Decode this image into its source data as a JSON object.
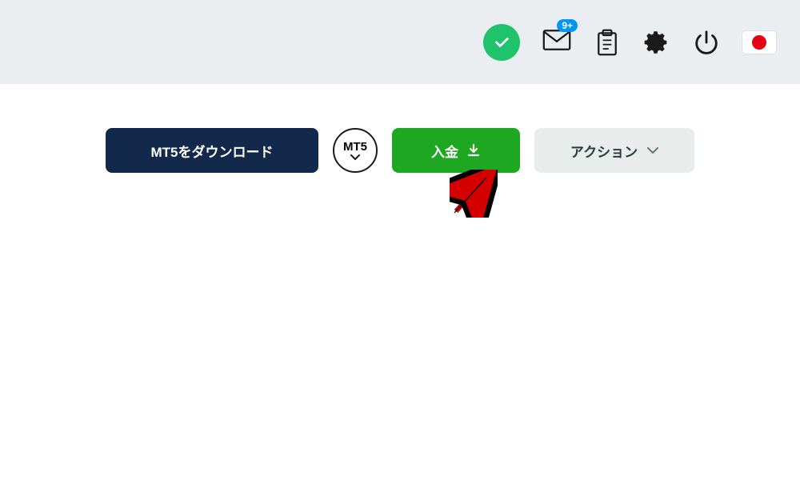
{
  "topbar": {
    "notification_badge": "9+"
  },
  "buttons": {
    "download_label": "MT5をダウンロード",
    "platform_label": "MT5",
    "deposit_label": "入金",
    "action_label": "アクション"
  },
  "colors": {
    "status_green": "#1fc36b",
    "badge_blue": "#0096f7",
    "primary_navy": "#13294b",
    "deposit_green": "#1ea821",
    "action_gray": "#e8eceb",
    "flag_red": "#e60012"
  }
}
